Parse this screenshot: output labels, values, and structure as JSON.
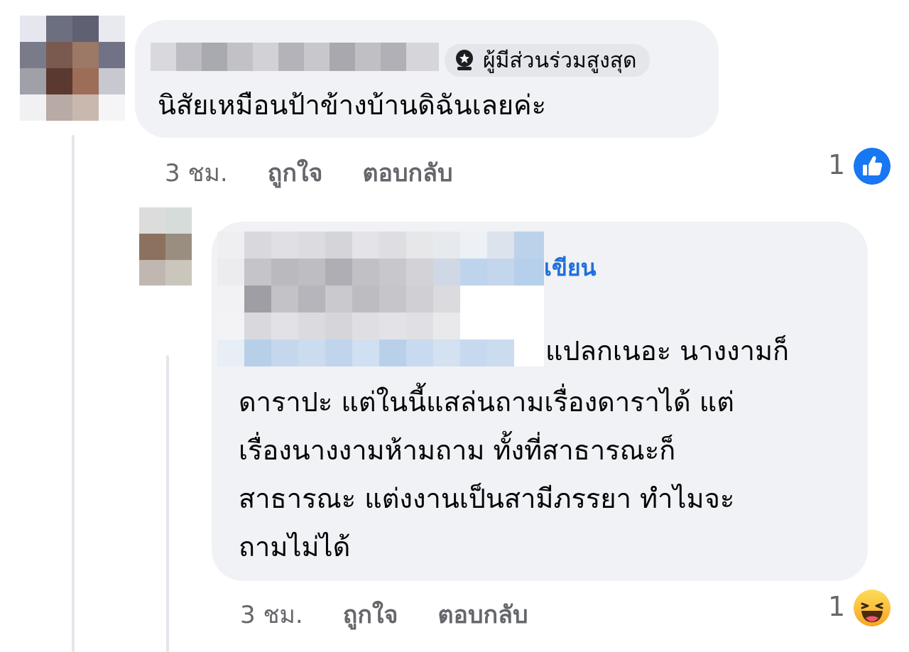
{
  "comments": [
    {
      "badge": "ผู้มีส่วนร่วมสูงสุด",
      "text": "นิสัยเหมือนป้าข้างบ้านดิฉันเลยค่ะ",
      "time": "3 ชม.",
      "like_label": "ถูกใจ",
      "reply_label": "ตอบกลับ",
      "reaction_count": "1",
      "reaction_icon": "like-icon"
    },
    {
      "author_tag": "เขียน",
      "lines": [
        "แปลกเนอะ นางงามก็",
        "ดาราปะ แต่ในนี้แสล่นถามเรื่องดาราได้ แต่",
        "เรื่องนางงามห้ามถาม ทั้งที่สาธารณะก็",
        "สาธารณะ แต่งงานเป็นสามีภรรยา ทำไมจะ",
        "ถามไม่ได้"
      ],
      "time": "3 ชม.",
      "like_label": "ถูกใจ",
      "reply_label": "ตอบกลับ",
      "reaction_count": "1",
      "reaction_icon": "haha-icon"
    }
  ],
  "colors": {
    "bubble": "#f0f2f5",
    "meta_text": "#65676b",
    "like_blue": "#1877f2",
    "author_tag_blue": "#216fdb",
    "haha_yellow": "#f7b928"
  }
}
